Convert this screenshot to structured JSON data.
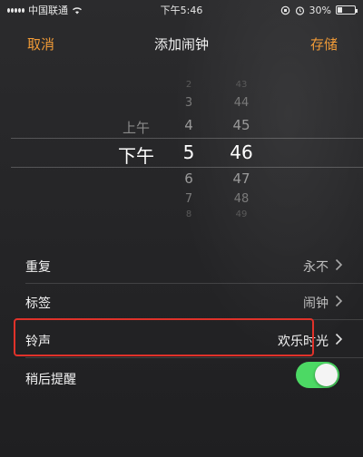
{
  "status_bar": {
    "carrier": "中国联通",
    "time": "下午5:46",
    "battery": "30%",
    "battery_level": 0.3
  },
  "nav": {
    "cancel": "取消",
    "title": "添加闹钟",
    "save": "存储"
  },
  "picker": {
    "ampm": {
      "above": "上午",
      "selected": "下午"
    },
    "hours": {
      "far_above": "2",
      "above_2": "3",
      "above_1": "4",
      "selected": "5",
      "below_1": "6",
      "below_2": "7",
      "far_below": "8"
    },
    "minutes": {
      "far_above": "43",
      "above_2": "44",
      "above_1": "45",
      "selected": "46",
      "below_1": "47",
      "below_2": "48",
      "far_below": "49"
    }
  },
  "settings": {
    "repeat": {
      "label": "重复",
      "value": "永不"
    },
    "label": {
      "label": "标签",
      "value": "闹钟"
    },
    "sound": {
      "label": "铃声",
      "value": "欢乐时光"
    },
    "snooze": {
      "label": "稍后提醒",
      "enabled": true
    }
  },
  "colors": {
    "accent": "#f09a37",
    "toggle_on": "#4cd964",
    "highlight": "#e0322a"
  }
}
